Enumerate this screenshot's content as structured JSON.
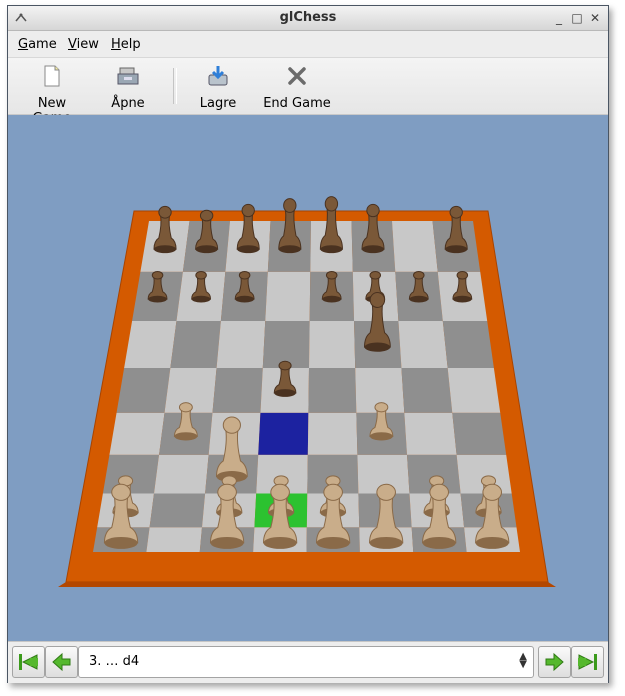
{
  "window": {
    "title": "glChess"
  },
  "menubar": {
    "items": [
      {
        "prefix": "",
        "ul": "G",
        "rest": "ame"
      },
      {
        "prefix": "",
        "ul": "V",
        "rest": "iew"
      },
      {
        "prefix": "",
        "ul": "H",
        "rest": "elp"
      }
    ]
  },
  "toolbar": {
    "new_game": "New Game",
    "open": "Åpne",
    "save": "Lagre",
    "end_game": "End Game"
  },
  "board": {
    "colors": {
      "frame": "#d45a00",
      "light_square": "#c8c8c8",
      "dark_square": "#8f8f8f",
      "highlight_blue": "#1c22a0",
      "highlight_green": "#2cc230",
      "background": "#7f9dc2"
    },
    "highlight_squares": [
      {
        "file": "d",
        "rank": 4,
        "color": "blue"
      },
      {
        "file": "d",
        "rank": 2,
        "color": "green"
      }
    ]
  },
  "statusbar": {
    "current_move": "3. … d4",
    "buttons": [
      "first-move",
      "previous-move",
      "next-move",
      "last-move"
    ]
  }
}
